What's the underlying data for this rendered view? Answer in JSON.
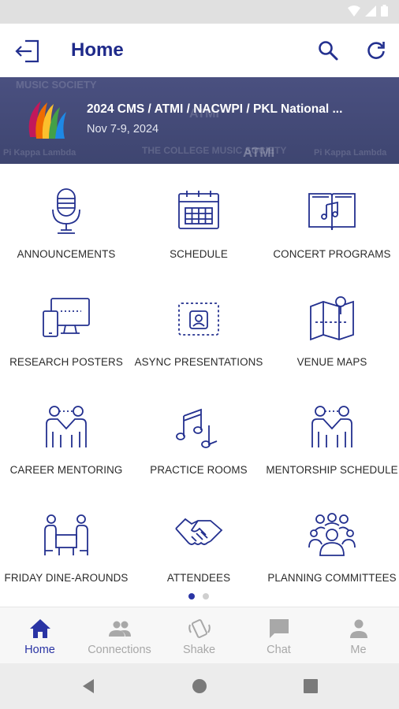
{
  "app_bar": {
    "title": "Home",
    "logout_icon": "logout-icon",
    "search_icon": "search-icon",
    "refresh_icon": "refresh-icon"
  },
  "banner": {
    "title": "2024 CMS / ATMI / NACWPI / PKL National ...",
    "date": "Nov 7-9, 2024",
    "background_texts": [
      "MUSIC SOCIETY",
      "ATMI",
      "Pi Kappa Lambda",
      "THE COLLEGE MUSIC SOCIETY",
      "ATMI",
      "Pi Kappa Lambda"
    ]
  },
  "tiles": [
    {
      "label": "ANNOUNCEMENTS",
      "icon": "microphone-icon"
    },
    {
      "label": "SCHEDULE",
      "icon": "calendar-icon"
    },
    {
      "label": "CONCERT PROGRAMS",
      "icon": "music-book-icon"
    },
    {
      "label": "RESEARCH POSTERS",
      "icon": "devices-icon"
    },
    {
      "label": "ASYNC PRESENTATIONS",
      "icon": "video-call-icon"
    },
    {
      "label": "VENUE MAPS",
      "icon": "map-icon"
    },
    {
      "label": "CAREER MENTORING",
      "icon": "handshake-people-icon"
    },
    {
      "label": "PRACTICE ROOMS",
      "icon": "music-notes-icon"
    },
    {
      "label": "MENTORSHIP SCHEDULE",
      "icon": "handshake-people-icon"
    },
    {
      "label": "FRIDAY DINE-AROUNDS",
      "icon": "dining-table-icon"
    },
    {
      "label": "ATTENDEES",
      "icon": "handshake-icon"
    },
    {
      "label": "PLANNING COMMITTEES",
      "icon": "group-icon"
    }
  ],
  "pager": {
    "pages": 2,
    "current": 1
  },
  "bottom_nav": [
    {
      "label": "Home",
      "icon": "home-icon",
      "active": true
    },
    {
      "label": "Connections",
      "icon": "people-icon",
      "active": false
    },
    {
      "label": "Shake",
      "icon": "shake-phone-icon",
      "active": false
    },
    {
      "label": "Chat",
      "icon": "chat-icon",
      "active": false
    },
    {
      "label": "Me",
      "icon": "person-icon",
      "active": false
    }
  ],
  "colors": {
    "accent": "#2a34a4",
    "icon_stroke": "#23308f",
    "inactive": "#a8a8a8",
    "banner_bg": "#454b78"
  }
}
